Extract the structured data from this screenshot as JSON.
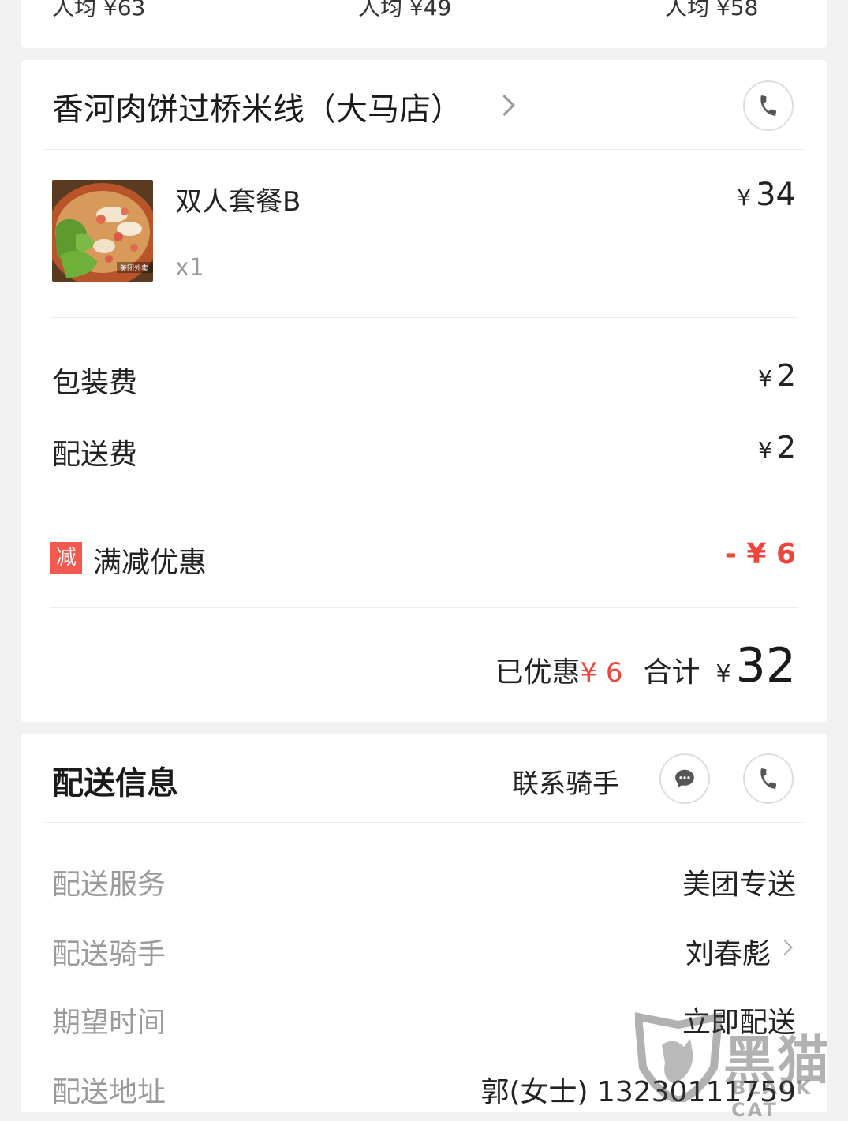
{
  "top_strip": {
    "averages": [
      "人均 ¥63",
      "人均 ¥49",
      "人均 ¥58"
    ]
  },
  "order": {
    "shop_name": "香河肉饼过桥米线（大马店）",
    "item": {
      "name": "双人套餐B",
      "qty": "x1",
      "price_symbol": "¥",
      "price": "34",
      "thumb_watermark": "美团外卖"
    },
    "fees": [
      {
        "label": "包装费",
        "symbol": "¥",
        "amount": "2"
      },
      {
        "label": "配送费",
        "symbol": "¥",
        "amount": "2"
      }
    ],
    "discount": {
      "tag": "减",
      "label": "满减优惠",
      "amount": "- ¥ 6"
    },
    "summary": {
      "saved_label": "已优惠",
      "saved_value": "¥ 6",
      "total_label": "合计",
      "total_symbol": "¥",
      "total_value": "32"
    }
  },
  "delivery": {
    "title": "配送信息",
    "contact_label": "联系骑手",
    "rows": [
      {
        "label": "配送服务",
        "value": "美团专送"
      },
      {
        "label": "配送骑手",
        "value": "刘春彪"
      },
      {
        "label": "期望时间",
        "value": "立即配送"
      },
      {
        "label": "配送地址",
        "value": "郭(女士) 13230111759"
      }
    ]
  },
  "watermark": {
    "text": "黑猫",
    "sub": "BLACK CAT"
  },
  "colors": {
    "accent_red": "#f0453b",
    "tag_red": "#f25a50",
    "muted_text": "#9a9a9a",
    "background": "#f1f1f1"
  }
}
